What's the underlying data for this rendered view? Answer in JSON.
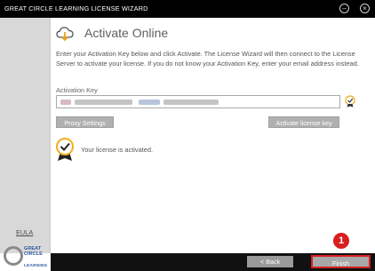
{
  "window": {
    "title": "GREAT CIRCLE LEARNING LICENSE WIZARD",
    "minimize_icon": "minus-icon",
    "close_icon": "close-icon"
  },
  "sidebar": {
    "eula_label": "EULA",
    "logo_line1": "GREAT",
    "logo_line2": "CIRCLE",
    "logo_line3": "LEARNING"
  },
  "main": {
    "heading": "Activate Online",
    "heading_icon": "cloud-download-icon",
    "instructions": "Enter your Activation Key below and click Activate. The License Wizard will then connect to the License Server to activate your license. If you do not know your Activation Key, enter your email address instead.",
    "activation_key_label": "Activation Key",
    "activation_key_value": "",
    "key_valid_icon": "checkmark-badge-icon",
    "proxy_button": "Proxy Settings",
    "activate_button": "Activate license key",
    "status_icon": "checkmark-badge-icon",
    "status_text": "Your license is activated."
  },
  "footer": {
    "back_button": "< Back",
    "finish_button": "Finish"
  },
  "annotation": {
    "step_number": "1",
    "color": "#d71f1f"
  },
  "colors": {
    "titlebar": "#000000",
    "sidebar": "#d8d8d8",
    "button_gray": "#b0b0b0",
    "highlight": "#d71f1f"
  }
}
